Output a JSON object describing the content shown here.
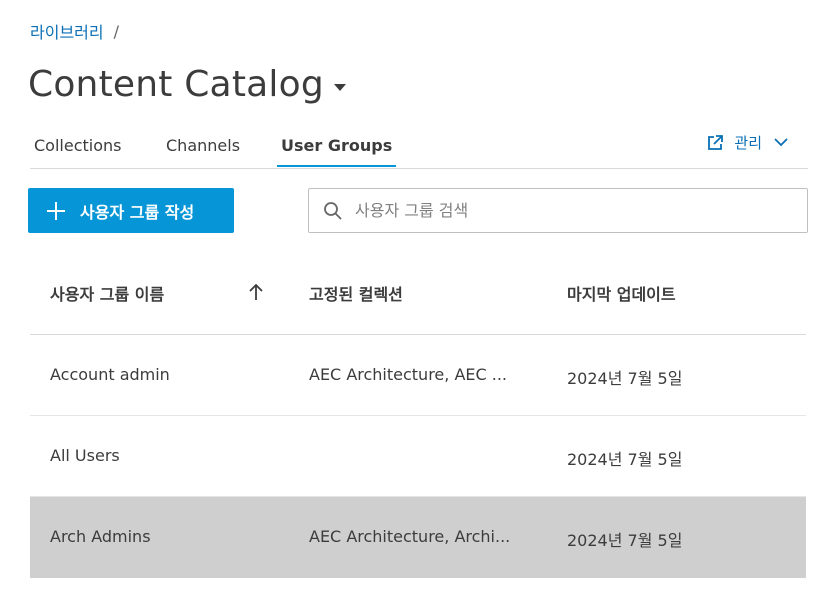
{
  "breadcrumb": {
    "items": [
      "라이브러리"
    ],
    "separator": "/"
  },
  "title": "Content Catalog",
  "tabs": [
    {
      "label": "Collections",
      "active": false
    },
    {
      "label": "Channels",
      "active": false
    },
    {
      "label": "User Groups",
      "active": true
    }
  ],
  "manage": {
    "label": "관리"
  },
  "create_button": {
    "label": "사용자 그룹 작성"
  },
  "search": {
    "placeholder": "사용자 그룹 검색",
    "value": ""
  },
  "table": {
    "headers": [
      "사용자 그룹 이름",
      "고정된 컬렉션",
      "마지막 업데이트"
    ],
    "sort": "ascending",
    "rows": [
      {
        "name": "Account admin",
        "collections": "AEC Architecture, AEC ...",
        "updated": "2024년 7월 5일",
        "selected": false
      },
      {
        "name": "All Users",
        "collections": "",
        "updated": "2024년 7월 5일",
        "selected": false
      },
      {
        "name": "Arch Admins",
        "collections": "AEC Architecture, Archi...",
        "updated": "2024년 7월 5일",
        "selected": true
      }
    ]
  },
  "colors": {
    "accent": "#0696d7",
    "link": "#0a6fb4",
    "selected_row": "#cfcfcf"
  }
}
